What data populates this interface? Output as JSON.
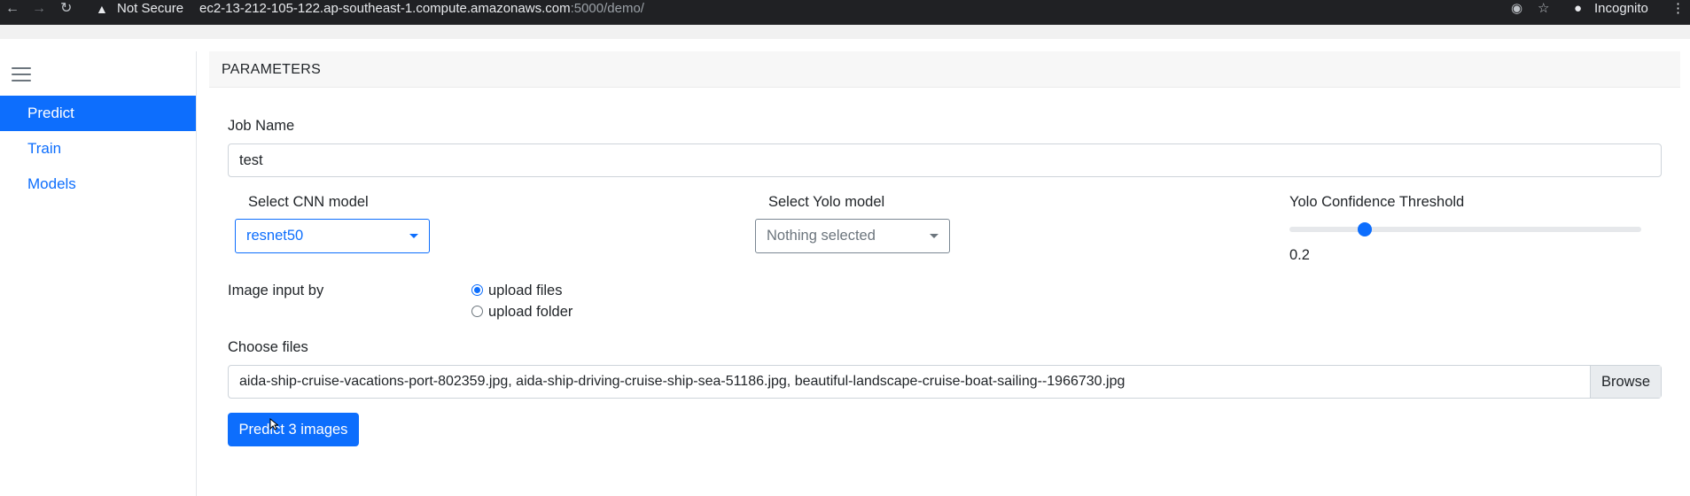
{
  "browser": {
    "security_label": "Not Secure",
    "url_host": "ec2-13-212-105-122.ap-southeast-1.compute.amazonaws.com",
    "url_rest": ":5000/demo/",
    "profile_label": "Incognito",
    "icons": [
      "back-icon",
      "forward-icon",
      "reload-icon",
      "warning-icon",
      "eye-off-icon",
      "star-icon",
      "incognito-icon",
      "kebab-menu-icon"
    ]
  },
  "sidebar": {
    "items": [
      {
        "label": "Predict",
        "active": true
      },
      {
        "label": "Train",
        "active": false
      },
      {
        "label": "Models",
        "active": false
      }
    ]
  },
  "card": {
    "header": "PARAMETERS"
  },
  "form": {
    "job_name_label": "Job Name",
    "job_name_value": "test",
    "cnn_label": "Select CNN model",
    "cnn_value": "resnet50",
    "yolo_label": "Select Yolo model",
    "yolo_value": "Nothing selected",
    "threshold_label": "Yolo Confidence Threshold",
    "threshold_value": "0.2",
    "image_input_label": "Image input by",
    "radio_files": "upload files",
    "radio_folder": "upload folder",
    "radio_selected": "upload files",
    "choose_files_label": "Choose files",
    "files_value": "aida-ship-cruise-vacations-port-802359.jpg, aida-ship-driving-cruise-ship-sea-51186.jpg, beautiful-landscape-cruise-boat-sailing--1966730.jpg",
    "browse_label": "Browse",
    "submit_label": "Predict 3 images"
  },
  "colors": {
    "primary": "#0d6efd",
    "browser_bar": "#202124"
  }
}
